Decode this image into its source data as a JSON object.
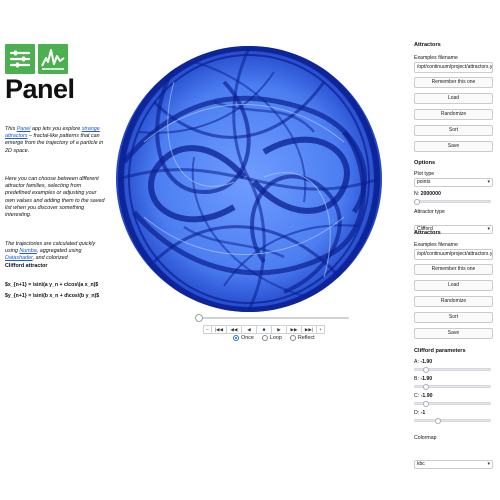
{
  "logo": {
    "word": "Panel"
  },
  "intro": {
    "p1_pre": "This ",
    "p1_link1": "Panel",
    "p1_mid": " app lets you explore ",
    "p1_link2": "strange attractors",
    "p1_post": " – fractal-like patterns that can emerge from the trajectory of a particle in 2D space.",
    "p2": "Here you can choose between different attractor families, selecting from predefined examples or adjusting your own values and adding them to the saved list when you discover something interesting.",
    "p3_pre": "The trajectories are calculated quickly using ",
    "p3_link1": "Numba",
    "p3_mid": ", aggregated using ",
    "p3_link2": "Datashader",
    "p3_post": ", and colorized",
    "overlap_title": "Clifford attractor",
    "formula1": "$x_{n+1} = \\sin\\(a y_n + c\\cos\\(a x_n)$",
    "formula2": "$y_{n+1} = \\sin\\(b x_n + d\\cos\\(b y_n)$"
  },
  "player": {
    "buttons": [
      "–",
      "|◀◀",
      "◀◀",
      "◀",
      "■",
      "▶",
      "▶▶",
      "▶▶|",
      "+"
    ],
    "modes": [
      {
        "label": "Once",
        "selected": true
      },
      {
        "label": "Loop",
        "selected": false
      },
      {
        "label": "Reflect",
        "selected": false
      }
    ]
  },
  "panel": {
    "attractors1": {
      "title": "Attractors",
      "filename_label": "Examples filename",
      "filename_value": "/opt/continuum/project/attractors.yml",
      "buttons": [
        "Remember this one",
        "Load",
        "Randomize",
        "Sort",
        "Save"
      ]
    },
    "options": {
      "title": "Options",
      "plot_type_label": "Plot type",
      "plot_type_value": "points",
      "n_label": "N:",
      "n_value": "2000000",
      "n_fraction": 0.0,
      "attractor_type_label": "Attractor type",
      "attractor_type_value": "Clifford"
    },
    "attractors2": {
      "title": "Attractors",
      "filename_label": "Examples filename",
      "filename_value": "/opt/continuum/project/attractors.yml",
      "buttons": [
        "Remember this one",
        "Load",
        "Randomize",
        "Sort",
        "Save"
      ]
    },
    "params": {
      "title": "Clifford parameters",
      "items": [
        {
          "name": "A:",
          "value": "-1.90",
          "fraction": 0.12
        },
        {
          "name": "B:",
          "value": "-1.90",
          "fraction": 0.12
        },
        {
          "name": "C:",
          "value": "-1.90",
          "fraction": 0.12
        },
        {
          "name": "D:",
          "value": "-1",
          "fraction": 0.3
        }
      ],
      "colormap_label": "Colormap",
      "colormap_value": "kbc"
    }
  },
  "colors": {
    "accent": "#1a73e8",
    "logo_green": "#4caf50",
    "plot_dark": "#0a1f8f",
    "plot_light": "#a9c8ff"
  }
}
